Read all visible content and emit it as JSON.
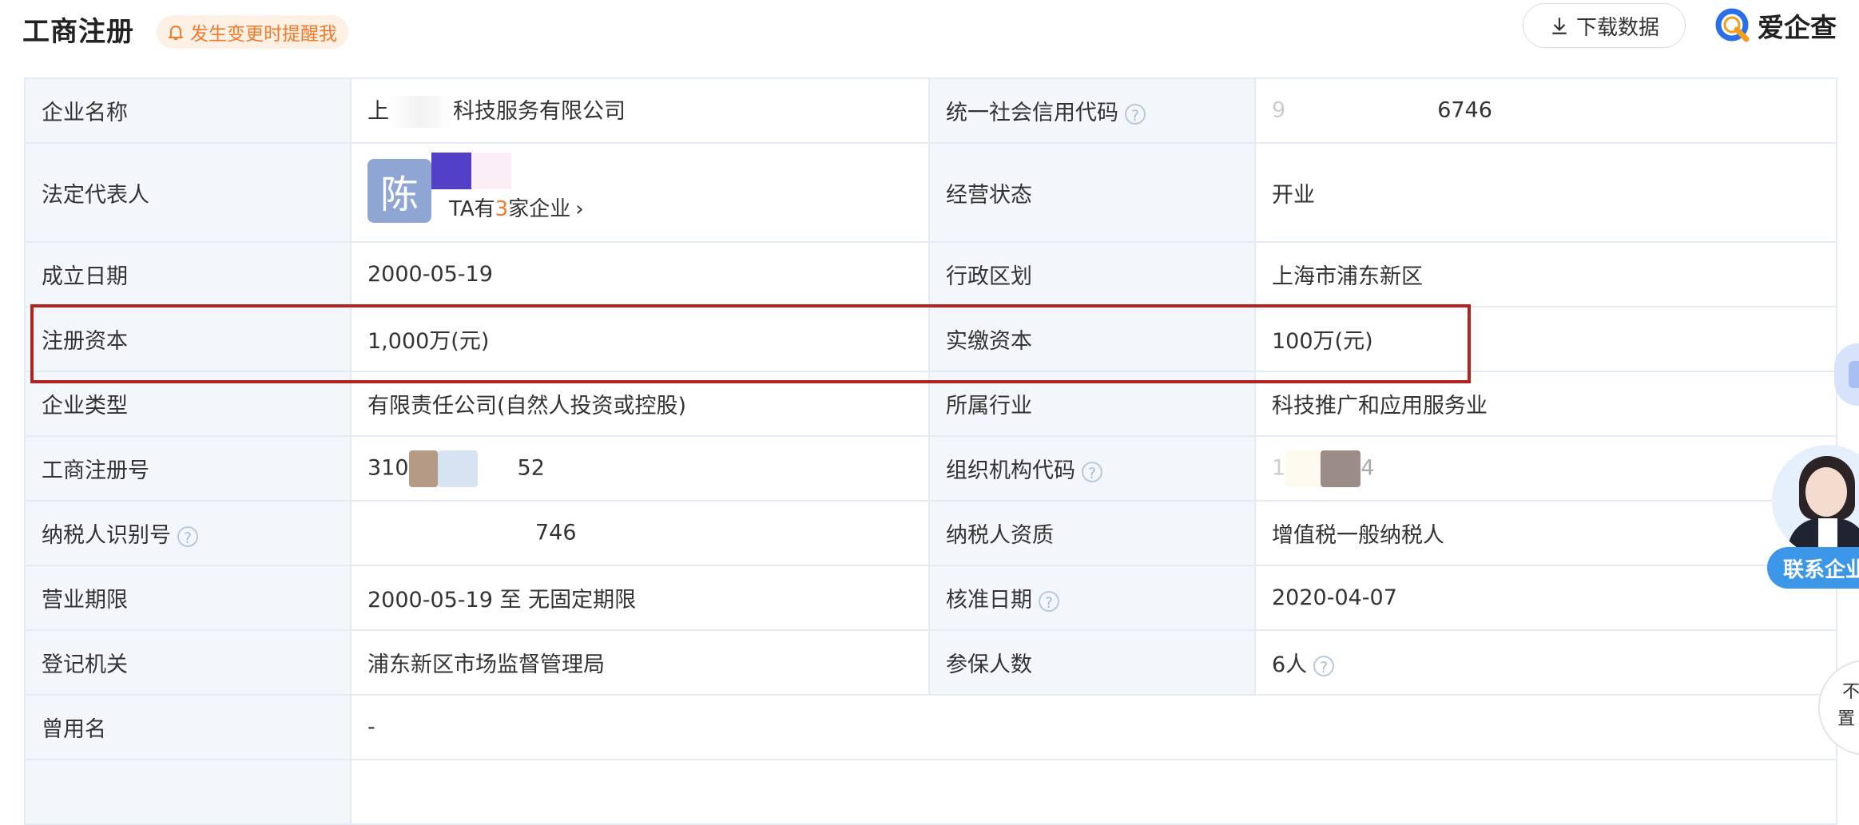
{
  "header": {
    "title": "工商注册",
    "remind_label": "发生变更时提醒我",
    "download_label": "下载数据",
    "brand_name": "爱企查"
  },
  "rows": [
    {
      "l1": "企业名称",
      "v1_prefix": "上",
      "v1_suffix": "科技服务有限公司",
      "l2": "统一社会信用代码",
      "v2_prefix": "9",
      "v2_suffix": "6746"
    },
    {
      "l1": "法定代表人",
      "avatar_char": "陈",
      "rep_count_prefix": "TA有",
      "rep_count_num": "3",
      "rep_count_suffix": "家企业",
      "l2": "经营状态",
      "v2": "开业"
    },
    {
      "l1": "成立日期",
      "v1": "2000-05-19",
      "l2": "行政区划",
      "v2": "上海市浦东新区"
    },
    {
      "l1": "注册资本",
      "v1": "1,000万(元)",
      "l2": "实缴资本",
      "v2": "100万(元)"
    },
    {
      "l1": "企业类型",
      "v1": "有限责任公司(自然人投资或控股)",
      "l2": "所属行业",
      "v2": "科技推广和应用服务业"
    },
    {
      "l1": "工商注册号",
      "v1_prefix": "310",
      "v1_suffix": "52",
      "l2": "组织机构代码",
      "v2_prefix": "1",
      "v2_suffix": "4"
    },
    {
      "l1": "纳税人识别号",
      "v1_suffix": "746",
      "l2": "纳税人资质",
      "v2": "增值税一般纳税人"
    },
    {
      "l1": "营业期限",
      "v1": "2000-05-19 至 无固定期限",
      "l2": "核准日期",
      "v2": "2020-04-07"
    },
    {
      "l1": "登记机关",
      "v1": "浦东新区市场监督管理局",
      "l2": "参保人数",
      "v2": "6人"
    },
    {
      "l1": "曾用名",
      "v1": "-"
    }
  ],
  "help_glyph": "?",
  "side": {
    "contact_label": "联系企业",
    "float_top": "不",
    "float_bottom": "置"
  },
  "colors": {
    "accent_orange": "#f07b2b",
    "label_bg": "#f3f7fc",
    "border": "#e4ebf3",
    "highlight": "#b0231f",
    "contact_blue": "#3d97e8"
  }
}
